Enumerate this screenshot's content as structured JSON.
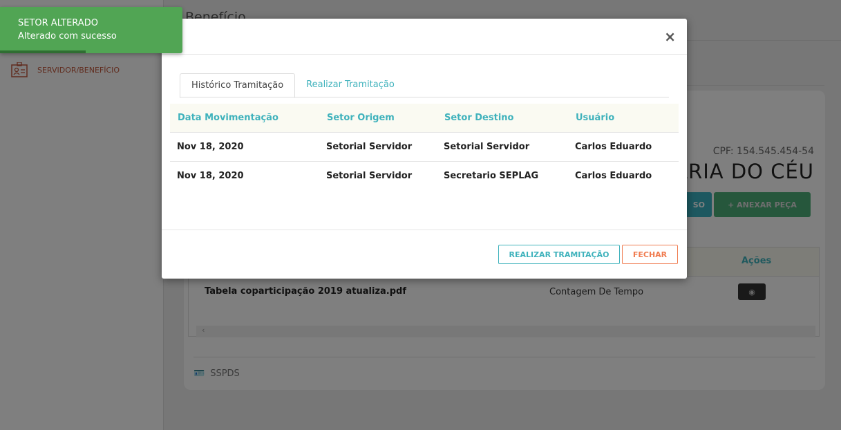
{
  "sidebar": {
    "item": "SERVIDOR/BENEFÍCIO"
  },
  "page": {
    "title": "Benefício",
    "cpf": "CPF: 154.545.454-54",
    "name": "ARIA DO CÉU",
    "btn_processo": "SO",
    "btn_anexar": "+ ANEXAR PEÇA",
    "actions_header": "Ações",
    "doc_name": "Tabela coparticipação 2019 atualiza.pdf",
    "doc_type": "Contagem De Tempo",
    "footer": "SSPDS"
  },
  "modal": {
    "close": "×",
    "tabs": [
      "Histórico Tramitação",
      "Realizar Tramitação"
    ],
    "headers": [
      "Data Movimentação",
      "Setor Origem",
      "Setor Destino",
      "Usuário"
    ],
    "rows": [
      [
        "Nov 18, 2020",
        "Setorial Servidor",
        "Setorial Servidor",
        "Carlos Eduardo"
      ],
      [
        "Nov 18, 2020",
        "Setorial Servidor",
        "Secretario SEPLAG",
        "Carlos Eduardo"
      ]
    ],
    "btn_realizar": "REALIZAR TRAMITAÇÃO",
    "btn_fechar": "FECHAR"
  },
  "toast": {
    "title": "SETOR ALTERADO",
    "message": "Alterado com sucesso",
    "progress": 0.47
  },
  "colors": {
    "accent": "#3fb2bc",
    "success": "#51a554",
    "danger": "#f07b4f"
  }
}
